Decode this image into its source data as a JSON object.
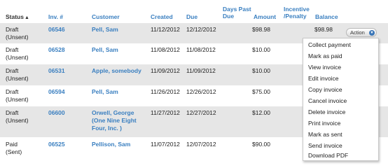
{
  "columns": {
    "status": "Status",
    "status_sort_icon": "sort-ascending-icon",
    "inv": "Inv. #",
    "customer": "Customer",
    "created": "Created",
    "due": "Due",
    "days_past_due_line1": "Days Past",
    "days_past_due_line2": "Due",
    "amount": "Amount",
    "incentive_line1": "Incentive",
    "incentive_line2": "/Penalty",
    "balance": "Balance"
  },
  "rows": [
    {
      "status1": "Draft",
      "status2": "(Unsent)",
      "inv": "06546",
      "customer1": "Pell, Sam",
      "customer2": "",
      "customer3": "",
      "created": "11/12/2012",
      "due": "12/12/2012",
      "amount": "$98.98",
      "balance": "$98.98"
    },
    {
      "status1": "Draft",
      "status2": "(Unsent)",
      "inv": "06528",
      "customer1": "Pell, Sam",
      "customer2": "",
      "customer3": "",
      "created": "11/08/2012",
      "due": "11/08/2012",
      "amount": "$10.00",
      "balance": ""
    },
    {
      "status1": "Draft",
      "status2": "(Unsent)",
      "inv": "06531",
      "customer1": "Apple, somebody",
      "customer2": "",
      "customer3": "",
      "created": "11/09/2012",
      "due": "11/09/2012",
      "amount": "$10.00",
      "balance": ""
    },
    {
      "status1": "Draft",
      "status2": "(Unsent)",
      "inv": "06594",
      "customer1": "Pell, Sam",
      "customer2": "",
      "customer3": "",
      "created": "11/26/2012",
      "due": "12/26/2012",
      "amount": "$75.00",
      "balance": ""
    },
    {
      "status1": "Draft",
      "status2": "(Unsent)",
      "inv": "06600",
      "customer1": "Orwell, George",
      "customer2": "(One Nine Eight",
      "customer3": "Four, Inc. )",
      "created": "11/27/2012",
      "due": "12/27/2012",
      "amount": "$12.00",
      "balance": ""
    },
    {
      "status1": "Paid",
      "status2": "(Sent)",
      "inv": "06525",
      "customer1": "Pellison, Sam",
      "customer2": "",
      "customer3": "",
      "created": "11/07/2012",
      "due": "12/07/2012",
      "amount": "$90.00",
      "balance": ""
    }
  ],
  "action": {
    "label": "Action",
    "icon": "chevron-down-circle-icon"
  },
  "menu": {
    "items": [
      "Collect payment",
      "Mark as paid",
      "View invoice",
      "Edit invoice",
      "Copy invoice",
      "Cancel invoice",
      "Delete invoice",
      "Print invoice",
      "Mark as sent",
      "Send invoice",
      "Download PDF"
    ]
  },
  "colors": {
    "link": "#3a7fc0",
    "shaded_row": "#e6e6e6",
    "action_icon": "#3a76b8"
  }
}
